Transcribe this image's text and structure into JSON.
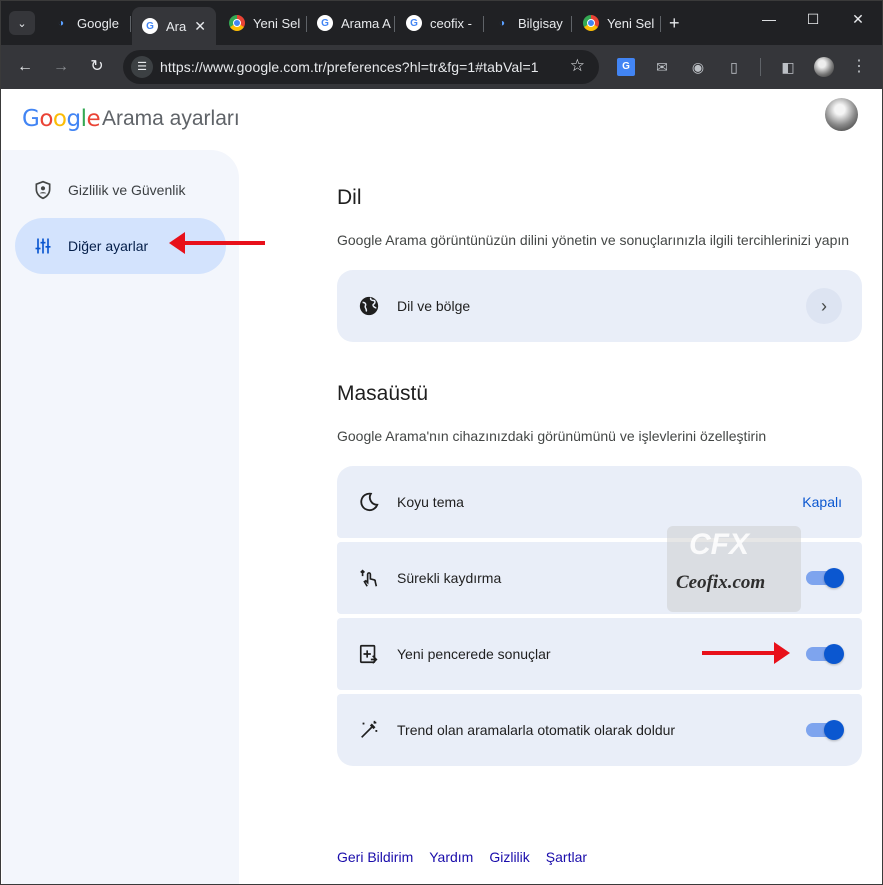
{
  "browser": {
    "tabs": [
      {
        "title": "Google",
        "icon": "ceofix-icon"
      },
      {
        "title": "Ara",
        "icon": "google-g-icon",
        "active": true
      },
      {
        "title": "Yeni Sel",
        "icon": "chrome-icon"
      },
      {
        "title": "Arama A",
        "icon": "google-g-icon"
      },
      {
        "title": "ceofix -",
        "icon": "google-g-icon"
      },
      {
        "title": "Bilgisay",
        "icon": "ceofix-icon"
      },
      {
        "title": "Yeni Sel",
        "icon": "chrome-icon"
      }
    ],
    "address_url": "https://www.google.com.tr/preferences?hl=tr&fg=1#tabVal=1"
  },
  "header": {
    "logo_letters": [
      "G",
      "o",
      "o",
      "g",
      "l",
      "e"
    ],
    "app_title": "Arama ayarları"
  },
  "sidebar": {
    "items": [
      {
        "label": "Gizlilik ve Güvenlik",
        "icon": "shield-icon",
        "active": false
      },
      {
        "label": "Diğer ayarlar",
        "icon": "sliders-icon",
        "active": true
      }
    ]
  },
  "sections": {
    "dil": {
      "title": "Dil",
      "description": "Google Arama görüntünüzün dilini yönetin ve sonuçlarınızla ilgili tercihlerinizi yapın",
      "rows": [
        {
          "label": "Dil ve bölge",
          "icon": "globe-icon"
        }
      ]
    },
    "masaustu": {
      "title": "Masaüstü",
      "description": "Google Arama'nın cihazınızdaki görünümünü ve işlevlerini özelleştirin",
      "rows": [
        {
          "label": "Koyu tema",
          "icon": "moon-icon",
          "value": "Kapalı"
        },
        {
          "label": "Sürekli kaydırma",
          "icon": "swipe-icon",
          "toggle_on": true
        },
        {
          "label": "Yeni pencerede sonuçlar",
          "icon": "new-window-icon",
          "toggle_on": true
        },
        {
          "label": "Trend olan aramalarla otomatik olarak doldur",
          "icon": "magic-wand-icon",
          "toggle_on": true
        }
      ]
    }
  },
  "footer": {
    "links": [
      "Geri Bildirim",
      "Yardım",
      "Gizlilik",
      "Şartlar"
    ]
  },
  "watermark": {
    "mark": "CFX",
    "text": "Ceofix.com"
  },
  "colors": {
    "accent": "#0b57d0",
    "card_bg": "#e9eef8",
    "sidebar_active": "#d3e3fd",
    "annotation_arrow": "#e8101a"
  }
}
